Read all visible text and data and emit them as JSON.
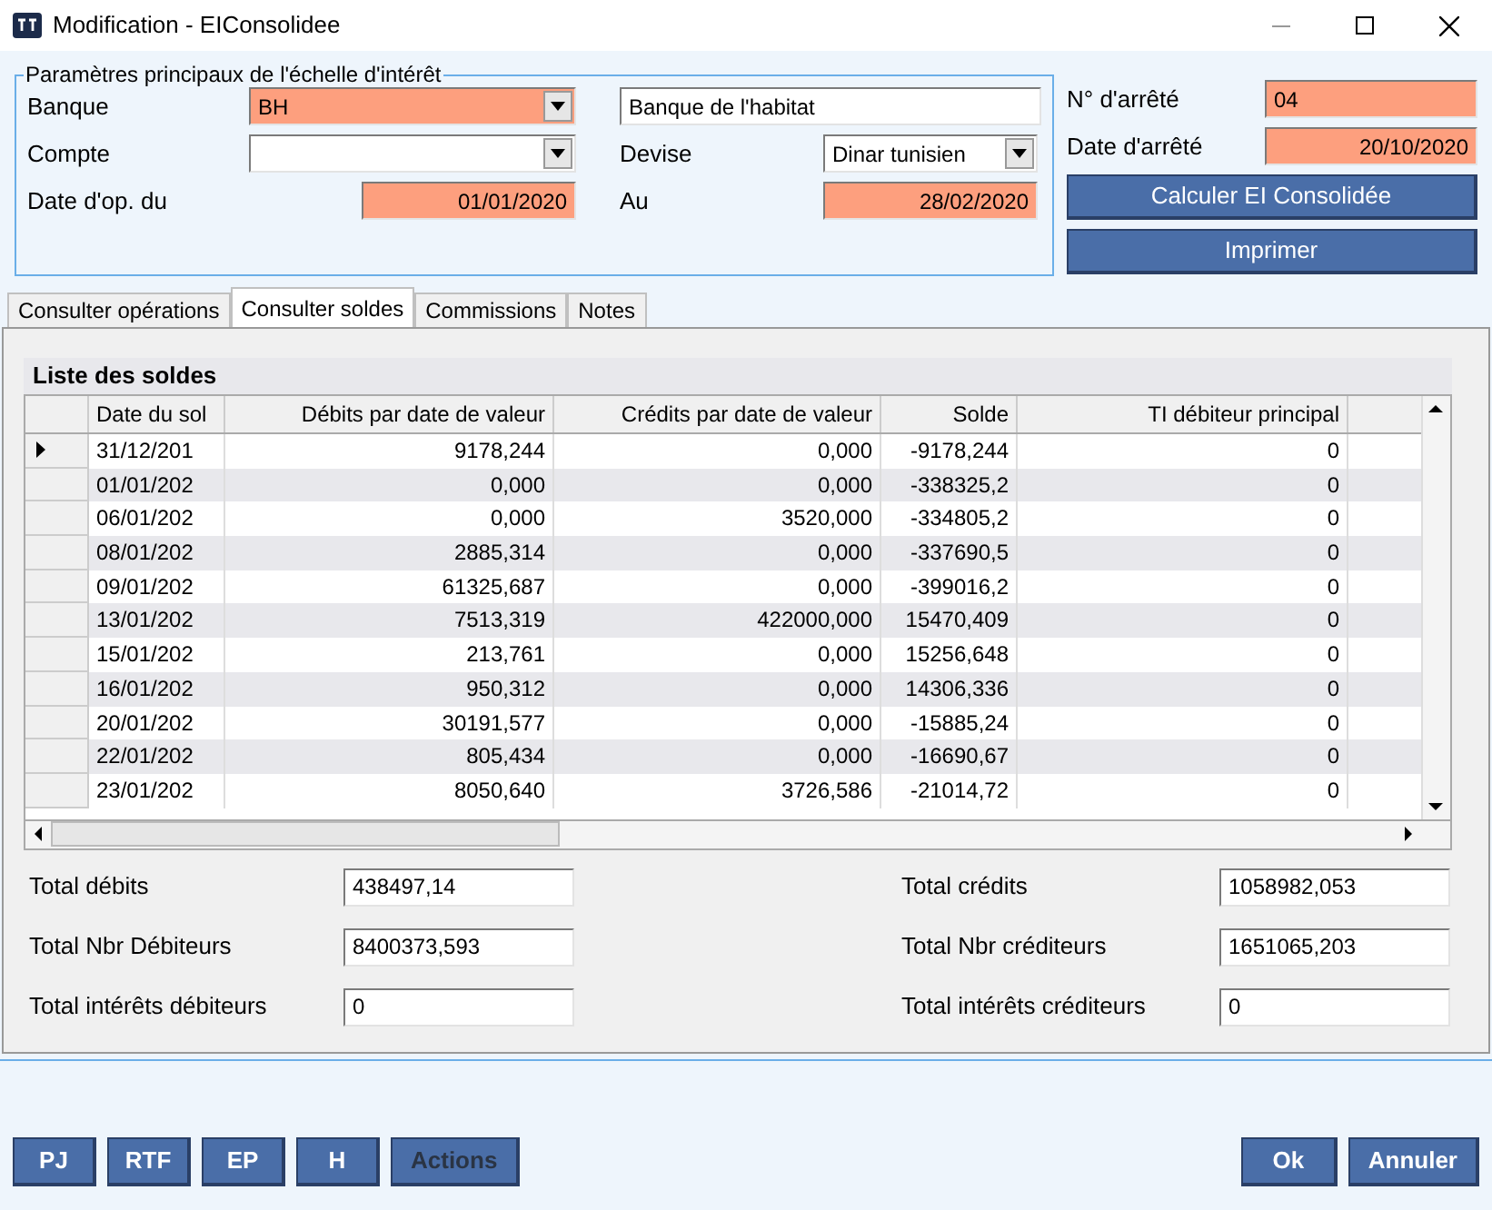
{
  "window": {
    "title": "Modification - EIConsolidee"
  },
  "params": {
    "legend": "Paramètres principaux de l'échelle d'intérêt",
    "banque": {
      "label": "Banque",
      "value": "BH",
      "name": "Banque de l'habitat"
    },
    "compte": {
      "label": "Compte"
    },
    "devise": {
      "label": "Devise",
      "value": "Dinar tunisien"
    },
    "date_du": {
      "label": "Date d'op. du",
      "value": "01/01/2020"
    },
    "au": {
      "label": "Au",
      "value": "28/02/2020"
    }
  },
  "arrete": {
    "numero": {
      "label": "N° d'arrêté",
      "value": "04"
    },
    "date": {
      "label": "Date d'arrêté",
      "value": "20/10/2020"
    }
  },
  "side_buttons": [
    "Calculer EI Consolidée",
    "Imprimer"
  ],
  "tabs": [
    {
      "label": "Consulter opérations",
      "selected": false
    },
    {
      "label": "Consulter soldes",
      "selected": true
    },
    {
      "label": "Commissions",
      "selected": false
    },
    {
      "label": "Notes",
      "selected": false
    }
  ],
  "grid": {
    "title": "Liste des soldes",
    "columns": [
      "Date du sol",
      "Débits par date de valeur",
      "Crédits par date de valeur",
      "Solde",
      "TI débiteur principal"
    ],
    "rows": [
      {
        "cells": [
          "31/12/201",
          "9178,244",
          "0,000",
          "-9178,244",
          "0"
        ],
        "selected": true
      },
      {
        "cells": [
          "01/01/202",
          "0,000",
          "0,000",
          "-338325,2",
          "0"
        ],
        "selected": false
      },
      {
        "cells": [
          "06/01/202",
          "0,000",
          "3520,000",
          "-334805,2",
          "0"
        ],
        "selected": false
      },
      {
        "cells": [
          "08/01/202",
          "2885,314",
          "0,000",
          "-337690,5",
          "0"
        ],
        "selected": false
      },
      {
        "cells": [
          "09/01/202",
          "61325,687",
          "0,000",
          "-399016,2",
          "0"
        ],
        "selected": false
      },
      {
        "cells": [
          "13/01/202",
          "7513,319",
          "422000,000",
          "15470,409",
          "0"
        ],
        "selected": false
      },
      {
        "cells": [
          "15/01/202",
          "213,761",
          "0,000",
          "15256,648",
          "0"
        ],
        "selected": false
      },
      {
        "cells": [
          "16/01/202",
          "950,312",
          "0,000",
          "14306,336",
          "0"
        ],
        "selected": false
      },
      {
        "cells": [
          "20/01/202",
          "30191,577",
          "0,000",
          "-15885,24",
          "0"
        ],
        "selected": false
      },
      {
        "cells": [
          "22/01/202",
          "805,434",
          "0,000",
          "-16690,67",
          "0"
        ],
        "selected": false
      },
      {
        "cells": [
          "23/01/202",
          "8050,640",
          "3726,586",
          "-21014,72",
          "0"
        ],
        "selected": false
      }
    ]
  },
  "totals_left": [
    {
      "label": "Total débits",
      "value": "438497,14"
    },
    {
      "label": "Total Nbr Débiteurs",
      "value": "8400373,593"
    },
    {
      "label": "Total intérêts débiteurs",
      "value": "0"
    }
  ],
  "totals_right": [
    {
      "label": "Total crédits",
      "value": "1058982,053"
    },
    {
      "label": "Total Nbr créditeurs",
      "value": "1651065,203"
    },
    {
      "label": "Total intérêts créditeurs",
      "value": "0"
    }
  ],
  "footer_left": [
    {
      "label": "PJ",
      "disabled": false
    },
    {
      "label": "RTF",
      "disabled": false
    },
    {
      "label": "EP",
      "disabled": false
    },
    {
      "label": "H",
      "disabled": false
    },
    {
      "label": "Actions",
      "disabled": true
    }
  ],
  "footer_right": [
    {
      "label": "Ok",
      "disabled": false
    },
    {
      "label": "Annuler",
      "disabled": false
    }
  ]
}
